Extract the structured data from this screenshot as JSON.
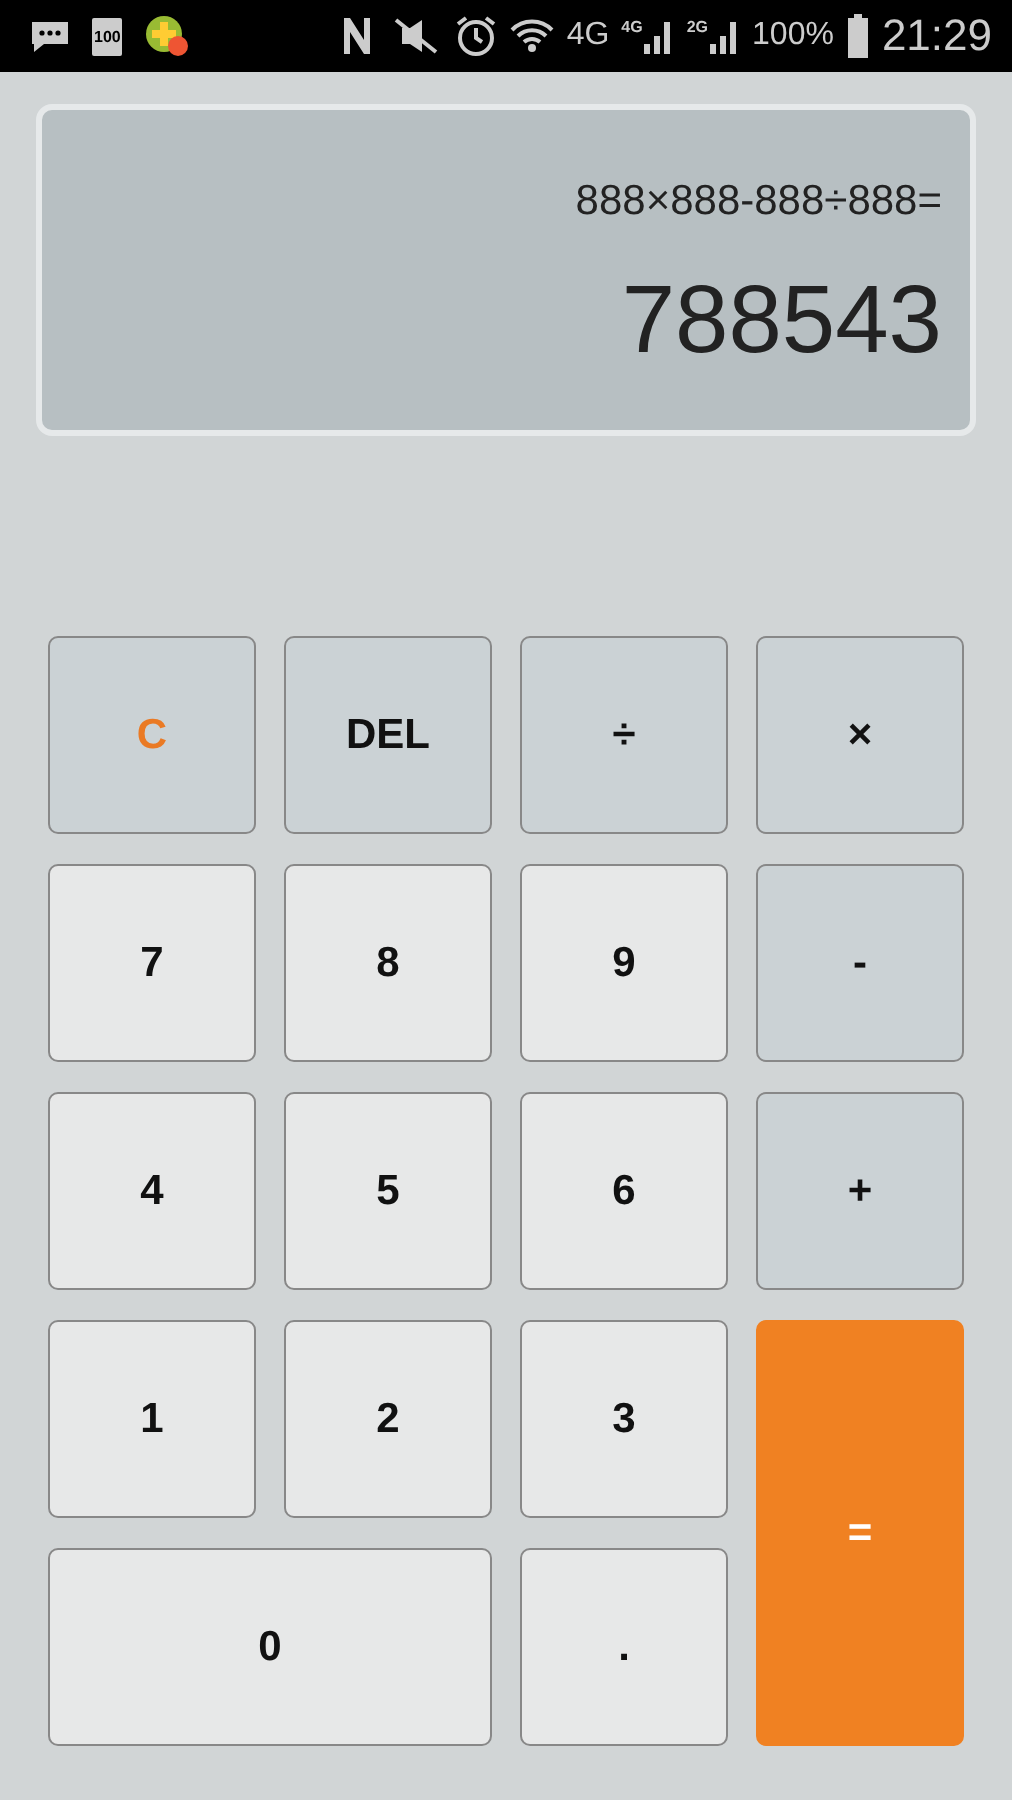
{
  "status_bar": {
    "battery_small": "100",
    "network": "4G",
    "sim1": "4G",
    "sim2": "2G",
    "battery": "100%",
    "time": "21:29"
  },
  "display": {
    "expression": "888×888-888÷888=",
    "result": "788543"
  },
  "keys": [
    {
      "label": "C",
      "kind": "clear",
      "wide": false
    },
    {
      "label": "DEL",
      "kind": "function",
      "wide": false
    },
    {
      "label": "÷",
      "kind": "operator",
      "wide": false
    },
    {
      "label": "×",
      "kind": "operator",
      "wide": false
    },
    {
      "label": "7",
      "kind": "digit",
      "wide": false
    },
    {
      "label": "8",
      "kind": "digit",
      "wide": false
    },
    {
      "label": "9",
      "kind": "digit",
      "wide": false
    },
    {
      "label": "-",
      "kind": "operator",
      "wide": false
    },
    {
      "label": "4",
      "kind": "digit",
      "wide": false
    },
    {
      "label": "5",
      "kind": "digit",
      "wide": false
    },
    {
      "label": "6",
      "kind": "digit",
      "wide": false
    },
    {
      "label": "+",
      "kind": "operator",
      "wide": false
    },
    {
      "label": "1",
      "kind": "digit",
      "wide": false
    },
    {
      "label": "2",
      "kind": "digit",
      "wide": false
    },
    {
      "label": "3",
      "kind": "digit",
      "wide": false
    },
    {
      "label": "=",
      "kind": "equals",
      "wide": false
    },
    {
      "label": "0",
      "kind": "digit",
      "wide": true
    },
    {
      "label": ".",
      "kind": "digit",
      "wide": false
    }
  ]
}
